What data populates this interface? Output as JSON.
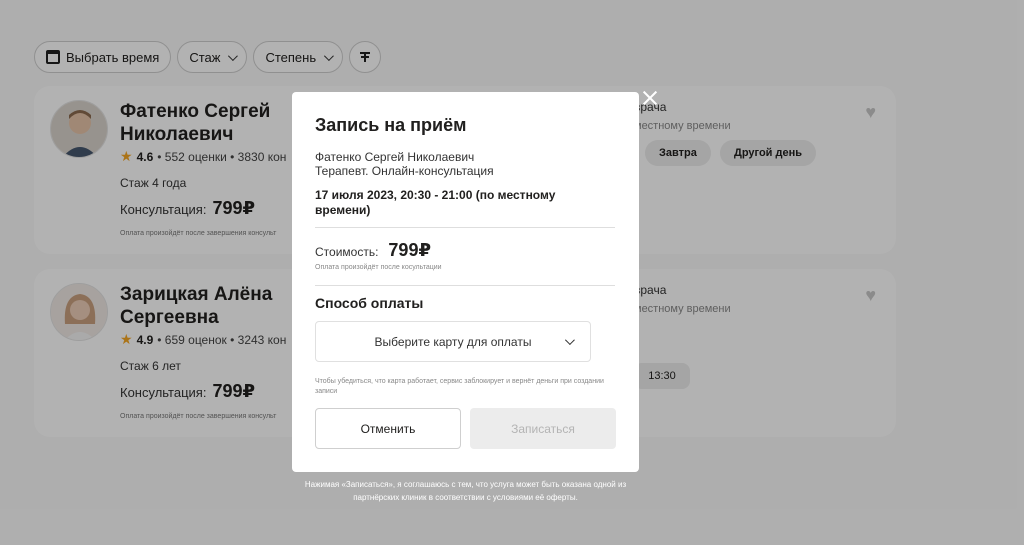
{
  "filters": {
    "time_label": "Выбрать время",
    "experience_label": "Стаж",
    "degree_label": "Степень"
  },
  "doctors": [
    {
      "name": "Фатенко Сергей Николаевич",
      "rating": "4.6",
      "reviews": "• 552 оценки • 3830 кон",
      "experience": "Стаж 4 года",
      "consult_label": "Консультация:",
      "price": "799₽",
      "note": "Оплата произойдёт после завершения консульт",
      "right_title": "врача",
      "right_sub": "местному времени",
      "slots": [
        "Завтра",
        "Другой день"
      ]
    },
    {
      "name": "Зарицкая Алёна Сергеевна",
      "rating": "4.9",
      "reviews": "• 659 оценок • 3243 кон",
      "experience": "Стаж 6 лет",
      "consult_label": "Консультация:",
      "price": "799₽",
      "note": "Оплата произойдёт после завершения консульт",
      "right_title": "врача",
      "right_sub": "местному времени",
      "slots": [
        "13:30"
      ]
    }
  ],
  "modal": {
    "title": "Запись на приём",
    "doctor": "Фатенко Сергей Николаевич",
    "specialty": "Терапевт. Онлайн-консультация",
    "datetime": "17 июля 2023, 20:30 - 21:00 (по местному времени)",
    "cost_label": "Стоимость:",
    "cost_value": "799₽",
    "cost_note": "Оплата произойдёт после косультации",
    "payment_title": "Способ оплаты",
    "card_select": "Выберите карту для оплаты",
    "card_note": "Чтобы убедиться, что карта работает, сервис заблокирует и вернёт деньги при создании записи",
    "cancel_label": "Отменить",
    "submit_label": "Записаться"
  },
  "legal": "Нажимая «Записаться», я соглашаюсь с тем, что услуга может быть оказана одной из партнёрских клиник в соответствии с условиями её оферты."
}
